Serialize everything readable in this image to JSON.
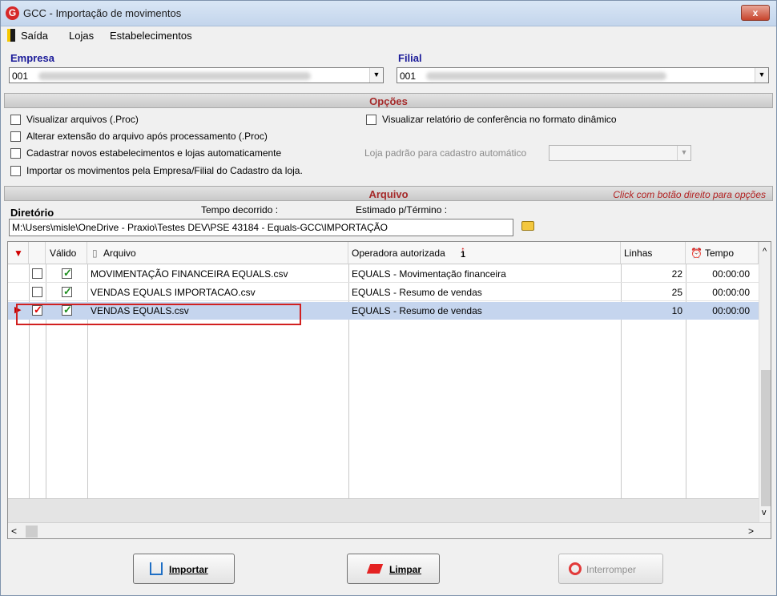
{
  "window": {
    "title": "GCC - Importação de movimentos",
    "close": "x"
  },
  "menu": {
    "items": [
      "Saída",
      "Lojas",
      "Estabelecimentos"
    ]
  },
  "empresa": {
    "label": "Empresa",
    "value": "001"
  },
  "filial": {
    "label": "Filial",
    "value": "001"
  },
  "opcoes": {
    "title": "Opções",
    "options": [
      "Visualizar arquivos (.Proc)",
      "Alterar extensão do arquivo após processamento (.Proc)",
      "Cadastrar novos estabelecimentos e lojas automaticamente",
      "Importar os movimentos pela Empresa/Filial do Cadastro da loja."
    ],
    "right_option": "Visualizar relatório de conferência no formato dinâmico",
    "loja_padrao_label": "Loja padrão para cadastro automático"
  },
  "arquivo": {
    "title": "Arquivo",
    "hint": "Click com botão direito para opções",
    "diretorio_label": "Diretório",
    "tempo_label": "Tempo decorrido :",
    "estimado_label": "Estimado p/Término :",
    "diretorio_value": "M:\\Users\\misle\\OneDrive - Praxio\\Testes DEV\\PSE 43184 - Equals-GCC\\IMPORTAÇÃO"
  },
  "grid": {
    "headers": {
      "valido": "Válido",
      "arquivo": "Arquivo",
      "operadora": "Operadora autorizada",
      "sort": "1",
      "linhas": "Linhas",
      "tempo": "Tempo"
    },
    "rows": [
      {
        "arquivo": "MOVIMENTAÇÃO FINANCEIRA EQUALS.csv",
        "operadora": "EQUALS - Movimentação financeira",
        "linhas": "22",
        "tempo": "00:00:00",
        "checked": false,
        "valido": true,
        "selected": false
      },
      {
        "arquivo": "VENDAS EQUALS IMPORTACAO.csv",
        "operadora": "EQUALS - Resumo de vendas",
        "linhas": "25",
        "tempo": "00:00:00",
        "checked": false,
        "valido": true,
        "selected": false
      },
      {
        "arquivo": "VENDAS EQUALS.csv",
        "operadora": "EQUALS - Resumo de vendas",
        "linhas": "10",
        "tempo": "00:00:00",
        "checked": true,
        "valido": true,
        "selected": true
      }
    ]
  },
  "buttons": {
    "importar": "Importar",
    "limpar": "Limpar",
    "interromper": "Interromper"
  }
}
